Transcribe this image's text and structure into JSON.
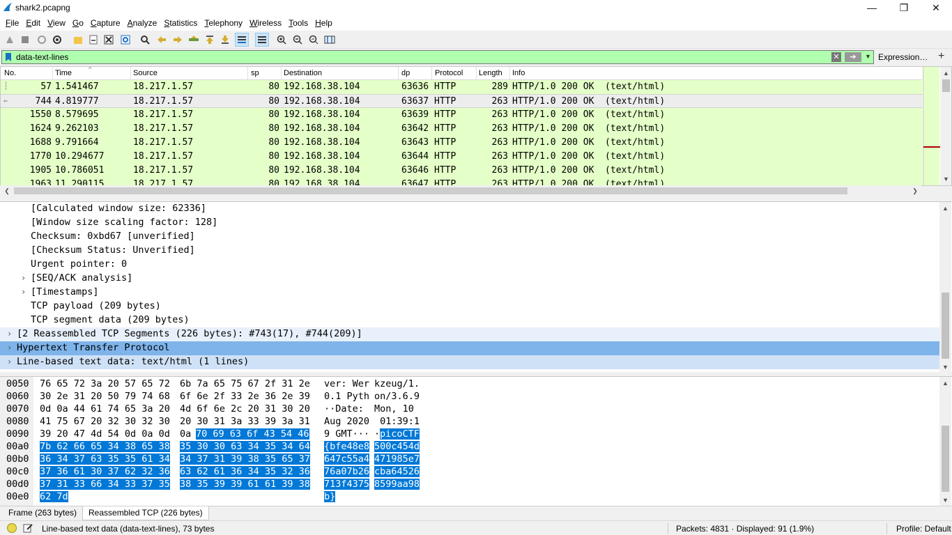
{
  "window": {
    "title": "shark2.pcapng"
  },
  "menu": [
    "File",
    "Edit",
    "View",
    "Go",
    "Capture",
    "Analyze",
    "Statistics",
    "Telephony",
    "Wireless",
    "Tools",
    "Help"
  ],
  "filter": {
    "value": "data-text-lines",
    "expression_label": "Expression…",
    "add_label": "+"
  },
  "packet_list": {
    "columns": [
      "No.",
      "Time",
      "Source",
      "sp",
      "Destination",
      "dp",
      "Protocol",
      "Length",
      "Info"
    ],
    "rows": [
      {
        "no": "57",
        "time": "1.541467",
        "src": "18.217.1.57",
        "sp": "80",
        "dst": "192.168.38.104",
        "dp": "63636",
        "proto": "HTTP",
        "len": "289",
        "info": "HTTP/1.0 200 OK  (text/html)"
      },
      {
        "no": "744",
        "time": "4.819777",
        "src": "18.217.1.57",
        "sp": "80",
        "dst": "192.168.38.104",
        "dp": "63637",
        "proto": "HTTP",
        "len": "263",
        "info": "HTTP/1.0 200 OK  (text/html)"
      },
      {
        "no": "1550",
        "time": "8.579695",
        "src": "18.217.1.57",
        "sp": "80",
        "dst": "192.168.38.104",
        "dp": "63639",
        "proto": "HTTP",
        "len": "263",
        "info": "HTTP/1.0 200 OK  (text/html)"
      },
      {
        "no": "1624",
        "time": "9.262103",
        "src": "18.217.1.57",
        "sp": "80",
        "dst": "192.168.38.104",
        "dp": "63642",
        "proto": "HTTP",
        "len": "263",
        "info": "HTTP/1.0 200 OK  (text/html)"
      },
      {
        "no": "1688",
        "time": "9.791664",
        "src": "18.217.1.57",
        "sp": "80",
        "dst": "192.168.38.104",
        "dp": "63643",
        "proto": "HTTP",
        "len": "263",
        "info": "HTTP/1.0 200 OK  (text/html)"
      },
      {
        "no": "1770",
        "time": "10.294677",
        "src": "18.217.1.57",
        "sp": "80",
        "dst": "192.168.38.104",
        "dp": "63644",
        "proto": "HTTP",
        "len": "263",
        "info": "HTTP/1.0 200 OK  (text/html)"
      },
      {
        "no": "1905",
        "time": "10.786051",
        "src": "18.217.1.57",
        "sp": "80",
        "dst": "192.168.38.104",
        "dp": "63646",
        "proto": "HTTP",
        "len": "263",
        "info": "HTTP/1.0 200 OK  (text/html)"
      },
      {
        "no": "1963",
        "time": "11.290115",
        "src": "18.217.1.57",
        "sp": "80",
        "dst": "192.168.38.104",
        "dp": "63647",
        "proto": "HTTP",
        "len": "263",
        "info": "HTTP/1.0 200 OK  (text/html)"
      }
    ]
  },
  "details": [
    "[Calculated window size: 62336]",
    "[Window size scaling factor: 128]",
    "Checksum: 0xbd67 [unverified]",
    "[Checksum Status: Unverified]",
    "Urgent pointer: 0",
    "[SEQ/ACK analysis]",
    "[Timestamps]",
    "TCP payload (209 bytes)",
    "TCP segment data (209 bytes)",
    "[2 Reassembled TCP Segments (226 bytes): #743(17), #744(209)]",
    "Hypertext Transfer Protocol",
    "Line-based text data: text/html (1 lines)"
  ],
  "bytes": [
    {
      "off": "0050",
      "hex1": "76 65 72 3a 20 57 65 72",
      "hex2": "6b 7a 65 75 67 2f 31 2e",
      "ascii1": "ver: Wer",
      "ascii2": "kzeug/1."
    },
    {
      "off": "0060",
      "hex1": "30 2e 31 20 50 79 74 68",
      "hex2": "6f 6e 2f 33 2e 36 2e 39",
      "ascii1": "0.1 Pyth",
      "ascii2": "on/3.6.9"
    },
    {
      "off": "0070",
      "hex1": "0d 0a 44 61 74 65 3a 20",
      "hex2": "4d 6f 6e 2c 20 31 30 20",
      "ascii1": "··Date: ",
      "ascii2": "Mon, 10 "
    },
    {
      "off": "0080",
      "hex1": "41 75 67 20 32 30 32 30",
      "hex2": "20 30 31 3a 33 39 3a 31",
      "ascii1": "Aug 2020",
      "ascii2": " 01:39:1"
    },
    {
      "off": "0090",
      "hex1": "39 20 47 4d 54 0d 0a 0d",
      "hex2a": "0a ",
      "hex2b": "70 69 63 6f 43 54 46",
      "ascii1": "9 GMT···",
      "ascii2a": "·",
      "ascii2b": "picoCTF"
    },
    {
      "off": "00a0",
      "hex1": "7b 62 66 65 34 38 65 38",
      "hex2": "35 30 30 63 34 35 34 64",
      "ascii1": "{bfe48e8",
      "ascii2": "500c454d"
    },
    {
      "off": "00b0",
      "hex1": "36 34 37 63 35 35 61 34",
      "hex2": "34 37 31 39 38 35 65 37",
      "ascii1": "647c55a4",
      "ascii2": "471985e7"
    },
    {
      "off": "00c0",
      "hex1": "37 36 61 30 37 62 32 36",
      "hex2": "63 62 61 36 34 35 32 36",
      "ascii1": "76a07b26",
      "ascii2": "cba64526"
    },
    {
      "off": "00d0",
      "hex1": "37 31 33 66 34 33 37 35",
      "hex2": "38 35 39 39 61 61 39 38",
      "ascii1": "713f4375",
      "ascii2": "8599aa98"
    },
    {
      "off": "00e0",
      "hex1": "62 7d",
      "hex2": "",
      "ascii1": "b}",
      "ascii2": ""
    }
  ],
  "tabs": [
    "Frame (263 bytes)",
    "Reassembled TCP (226 bytes)"
  ],
  "status": {
    "field": "Line-based text data (data-text-lines), 73 bytes",
    "packets": "Packets: 4831 · Displayed: 91 (1.9%)",
    "profile": "Profile: Default"
  },
  "colors": {
    "row_bg": "#e4ffc7",
    "filter_bg": "#afffaf",
    "selection": "#0078d7",
    "detail_sel": "#7eb4ea"
  }
}
